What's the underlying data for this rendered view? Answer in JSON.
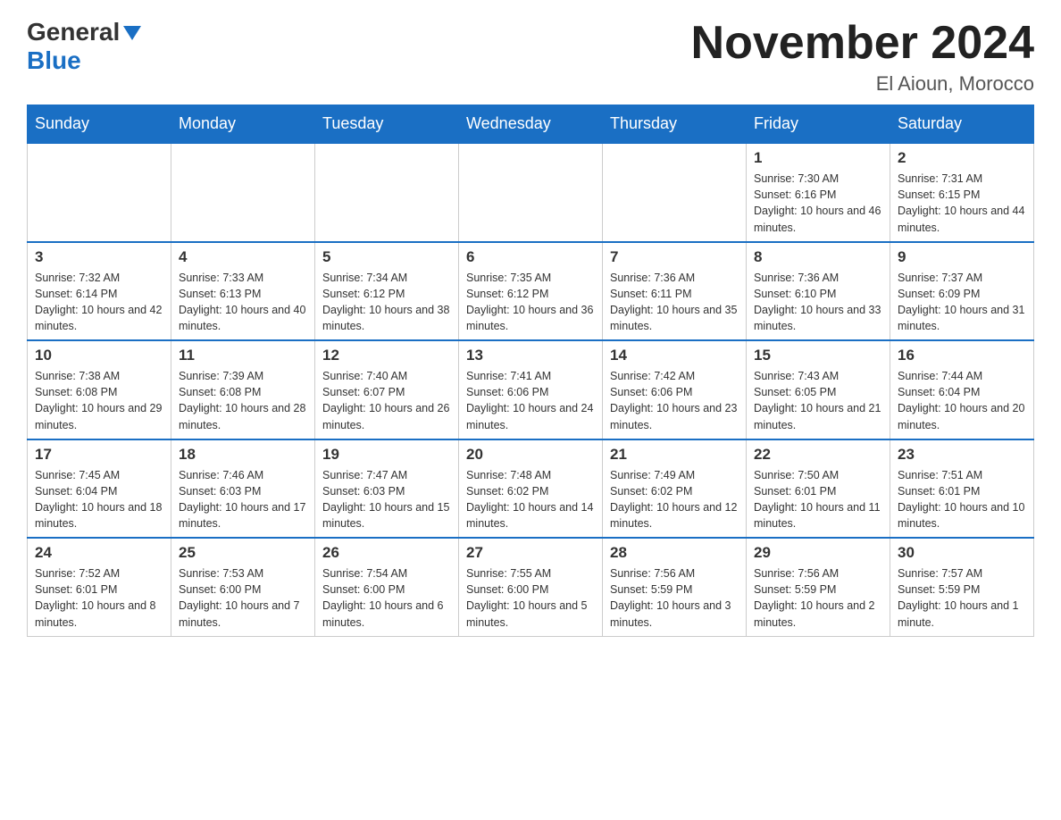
{
  "header": {
    "logo_general": "General",
    "logo_blue": "Blue",
    "month_title": "November 2024",
    "location": "El Aioun, Morocco"
  },
  "days_of_week": [
    "Sunday",
    "Monday",
    "Tuesday",
    "Wednesday",
    "Thursday",
    "Friday",
    "Saturday"
  ],
  "weeks": [
    [
      {
        "day": "",
        "empty": true
      },
      {
        "day": "",
        "empty": true
      },
      {
        "day": "",
        "empty": true
      },
      {
        "day": "",
        "empty": true
      },
      {
        "day": "",
        "empty": true
      },
      {
        "day": "1",
        "sunrise": "Sunrise: 7:30 AM",
        "sunset": "Sunset: 6:16 PM",
        "daylight": "Daylight: 10 hours and 46 minutes."
      },
      {
        "day": "2",
        "sunrise": "Sunrise: 7:31 AM",
        "sunset": "Sunset: 6:15 PM",
        "daylight": "Daylight: 10 hours and 44 minutes."
      }
    ],
    [
      {
        "day": "3",
        "sunrise": "Sunrise: 7:32 AM",
        "sunset": "Sunset: 6:14 PM",
        "daylight": "Daylight: 10 hours and 42 minutes."
      },
      {
        "day": "4",
        "sunrise": "Sunrise: 7:33 AM",
        "sunset": "Sunset: 6:13 PM",
        "daylight": "Daylight: 10 hours and 40 minutes."
      },
      {
        "day": "5",
        "sunrise": "Sunrise: 7:34 AM",
        "sunset": "Sunset: 6:12 PM",
        "daylight": "Daylight: 10 hours and 38 minutes."
      },
      {
        "day": "6",
        "sunrise": "Sunrise: 7:35 AM",
        "sunset": "Sunset: 6:12 PM",
        "daylight": "Daylight: 10 hours and 36 minutes."
      },
      {
        "day": "7",
        "sunrise": "Sunrise: 7:36 AM",
        "sunset": "Sunset: 6:11 PM",
        "daylight": "Daylight: 10 hours and 35 minutes."
      },
      {
        "day": "8",
        "sunrise": "Sunrise: 7:36 AM",
        "sunset": "Sunset: 6:10 PM",
        "daylight": "Daylight: 10 hours and 33 minutes."
      },
      {
        "day": "9",
        "sunrise": "Sunrise: 7:37 AM",
        "sunset": "Sunset: 6:09 PM",
        "daylight": "Daylight: 10 hours and 31 minutes."
      }
    ],
    [
      {
        "day": "10",
        "sunrise": "Sunrise: 7:38 AM",
        "sunset": "Sunset: 6:08 PM",
        "daylight": "Daylight: 10 hours and 29 minutes."
      },
      {
        "day": "11",
        "sunrise": "Sunrise: 7:39 AM",
        "sunset": "Sunset: 6:08 PM",
        "daylight": "Daylight: 10 hours and 28 minutes."
      },
      {
        "day": "12",
        "sunrise": "Sunrise: 7:40 AM",
        "sunset": "Sunset: 6:07 PM",
        "daylight": "Daylight: 10 hours and 26 minutes."
      },
      {
        "day": "13",
        "sunrise": "Sunrise: 7:41 AM",
        "sunset": "Sunset: 6:06 PM",
        "daylight": "Daylight: 10 hours and 24 minutes."
      },
      {
        "day": "14",
        "sunrise": "Sunrise: 7:42 AM",
        "sunset": "Sunset: 6:06 PM",
        "daylight": "Daylight: 10 hours and 23 minutes."
      },
      {
        "day": "15",
        "sunrise": "Sunrise: 7:43 AM",
        "sunset": "Sunset: 6:05 PM",
        "daylight": "Daylight: 10 hours and 21 minutes."
      },
      {
        "day": "16",
        "sunrise": "Sunrise: 7:44 AM",
        "sunset": "Sunset: 6:04 PM",
        "daylight": "Daylight: 10 hours and 20 minutes."
      }
    ],
    [
      {
        "day": "17",
        "sunrise": "Sunrise: 7:45 AM",
        "sunset": "Sunset: 6:04 PM",
        "daylight": "Daylight: 10 hours and 18 minutes."
      },
      {
        "day": "18",
        "sunrise": "Sunrise: 7:46 AM",
        "sunset": "Sunset: 6:03 PM",
        "daylight": "Daylight: 10 hours and 17 minutes."
      },
      {
        "day": "19",
        "sunrise": "Sunrise: 7:47 AM",
        "sunset": "Sunset: 6:03 PM",
        "daylight": "Daylight: 10 hours and 15 minutes."
      },
      {
        "day": "20",
        "sunrise": "Sunrise: 7:48 AM",
        "sunset": "Sunset: 6:02 PM",
        "daylight": "Daylight: 10 hours and 14 minutes."
      },
      {
        "day": "21",
        "sunrise": "Sunrise: 7:49 AM",
        "sunset": "Sunset: 6:02 PM",
        "daylight": "Daylight: 10 hours and 12 minutes."
      },
      {
        "day": "22",
        "sunrise": "Sunrise: 7:50 AM",
        "sunset": "Sunset: 6:01 PM",
        "daylight": "Daylight: 10 hours and 11 minutes."
      },
      {
        "day": "23",
        "sunrise": "Sunrise: 7:51 AM",
        "sunset": "Sunset: 6:01 PM",
        "daylight": "Daylight: 10 hours and 10 minutes."
      }
    ],
    [
      {
        "day": "24",
        "sunrise": "Sunrise: 7:52 AM",
        "sunset": "Sunset: 6:01 PM",
        "daylight": "Daylight: 10 hours and 8 minutes."
      },
      {
        "day": "25",
        "sunrise": "Sunrise: 7:53 AM",
        "sunset": "Sunset: 6:00 PM",
        "daylight": "Daylight: 10 hours and 7 minutes."
      },
      {
        "day": "26",
        "sunrise": "Sunrise: 7:54 AM",
        "sunset": "Sunset: 6:00 PM",
        "daylight": "Daylight: 10 hours and 6 minutes."
      },
      {
        "day": "27",
        "sunrise": "Sunrise: 7:55 AM",
        "sunset": "Sunset: 6:00 PM",
        "daylight": "Daylight: 10 hours and 5 minutes."
      },
      {
        "day": "28",
        "sunrise": "Sunrise: 7:56 AM",
        "sunset": "Sunset: 5:59 PM",
        "daylight": "Daylight: 10 hours and 3 minutes."
      },
      {
        "day": "29",
        "sunrise": "Sunrise: 7:56 AM",
        "sunset": "Sunset: 5:59 PM",
        "daylight": "Daylight: 10 hours and 2 minutes."
      },
      {
        "day": "30",
        "sunrise": "Sunrise: 7:57 AM",
        "sunset": "Sunset: 5:59 PM",
        "daylight": "Daylight: 10 hours and 1 minute."
      }
    ]
  ]
}
